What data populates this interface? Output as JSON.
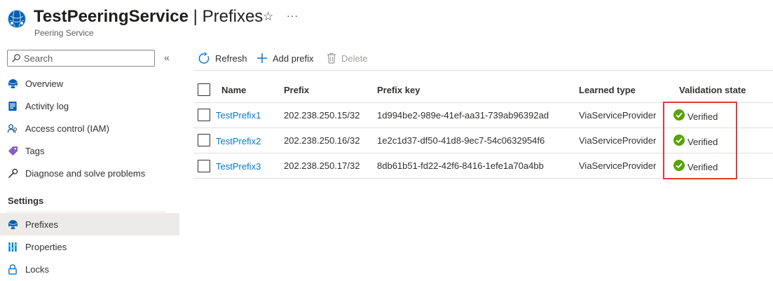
{
  "header": {
    "resource_name": "TestPeeringService",
    "separator": " | ",
    "page_name": "Prefixes",
    "subtitle": "Peering Service",
    "favorite_icon": "star-outline-icon",
    "more_icon": "ellipsis-icon",
    "more_label": "···"
  },
  "sidebar": {
    "search_placeholder": "Search",
    "collapse_label": "«",
    "items": [
      {
        "label": "Overview",
        "icon": "peering-service-icon"
      },
      {
        "label": "Activity log",
        "icon": "activity-log-icon"
      },
      {
        "label": "Access control (IAM)",
        "icon": "access-control-icon"
      },
      {
        "label": "Tags",
        "icon": "tag-icon"
      },
      {
        "label": "Diagnose and solve problems",
        "icon": "wrench-icon"
      }
    ],
    "settings_section": "Settings",
    "settings_items": [
      {
        "label": "Prefixes",
        "icon": "peering-service-icon",
        "active": true
      },
      {
        "label": "Properties",
        "icon": "properties-icon"
      },
      {
        "label": "Locks",
        "icon": "lock-icon"
      }
    ]
  },
  "toolbar": {
    "refresh_label": "Refresh",
    "add_label": "Add prefix",
    "delete_label": "Delete"
  },
  "table": {
    "columns": [
      "Name",
      "Prefix",
      "Prefix key",
      "Learned type",
      "Validation state"
    ],
    "rows": [
      {
        "name": "TestPrefix1",
        "prefix": "202.238.250.15/32",
        "prefix_key": "1d994be2-989e-41ef-aa31-739ab96392ad",
        "learned_type": "ViaServiceProvider",
        "validation_state": "Verified"
      },
      {
        "name": "TestPrefix2",
        "prefix": "202.238.250.16/32",
        "prefix_key": "1e2c1d37-df50-41d8-9ec7-54c0632954f6",
        "learned_type": "ViaServiceProvider",
        "validation_state": "Verified"
      },
      {
        "name": "TestPrefix3",
        "prefix": "202.238.250.17/32",
        "prefix_key": "8db61b51-fd22-42f6-8416-1efe1a70a4bb",
        "learned_type": "ViaServiceProvider",
        "validation_state": "Verified"
      }
    ]
  },
  "colors": {
    "link": "#0078d4",
    "verified": "#57a300",
    "highlight": "#e03a3a",
    "active_nav": "#edebe9",
    "disabled": "#a19f9d"
  }
}
